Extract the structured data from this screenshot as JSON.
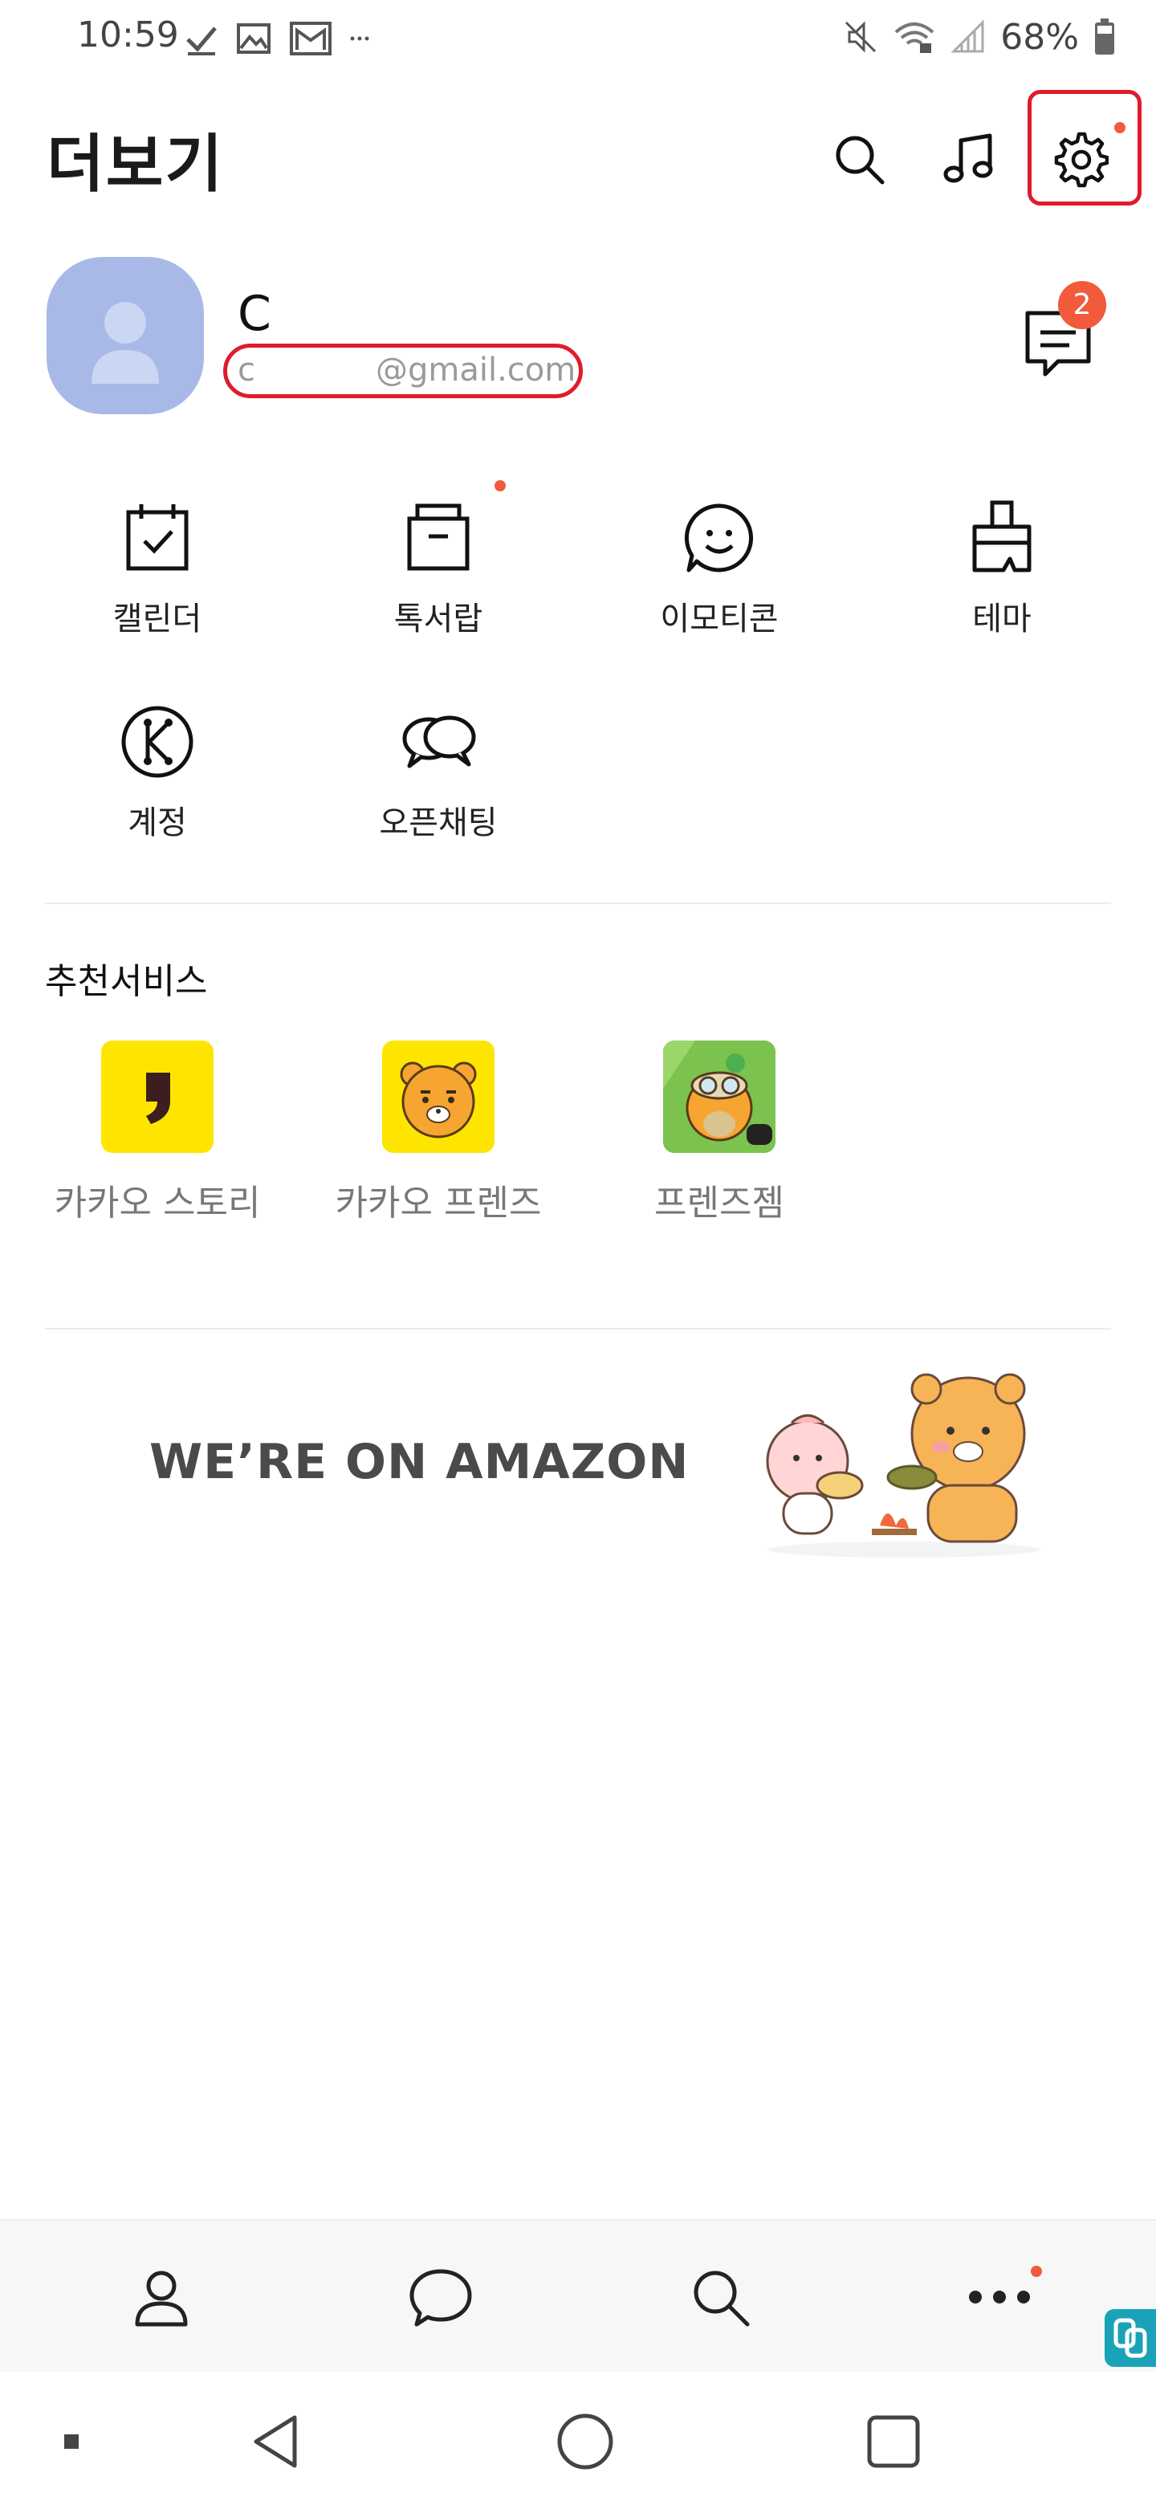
{
  "status_bar": {
    "time": "10:59",
    "battery": "68%",
    "left_icons": [
      "check-icon",
      "image-icon",
      "gmail-icon",
      "more-dots-icon"
    ],
    "right_icons": [
      "mute-icon",
      "wifi-icon",
      "signal-icon",
      "battery-icon"
    ]
  },
  "header": {
    "title": "더보기",
    "actions": [
      "search-icon",
      "music-icon",
      "settings-icon"
    ],
    "settings_has_dot": true
  },
  "profile": {
    "name": "C",
    "email_prefix": "c",
    "email_suffix": "@gmail.com",
    "unread_badge": "2"
  },
  "menu": {
    "items": [
      {
        "label": "캘린더",
        "icon": "calendar-icon"
      },
      {
        "label": "톡서랍",
        "icon": "drawer-icon"
      },
      {
        "label": "이모티콘",
        "icon": "emoticon-icon"
      },
      {
        "label": "테마",
        "icon": "theme-brush-icon"
      },
      {
        "label": "계정",
        "icon": "kakao-account-icon"
      },
      {
        "label": "오픈채팅",
        "icon": "open-chat-icon"
      }
    ]
  },
  "recommended": {
    "title": "추천서비스",
    "items": [
      {
        "label": "카카오 스토리",
        "icon": "kakao-story-icon"
      },
      {
        "label": "카카오 프렌즈",
        "icon": "kakao-friends-icon"
      },
      {
        "label": "프렌즈젬",
        "icon": "friends-gem-icon"
      }
    ]
  },
  "banner": {
    "text": "WE’RE ON AMAZON"
  },
  "bottom_nav": [
    "friends-icon",
    "chats-icon",
    "view-search-icon",
    "more-icon"
  ],
  "colors": {
    "accent_dot": "#f15a3a",
    "highlight": "#e01b2a",
    "kakao_yellow": "#fee500"
  }
}
